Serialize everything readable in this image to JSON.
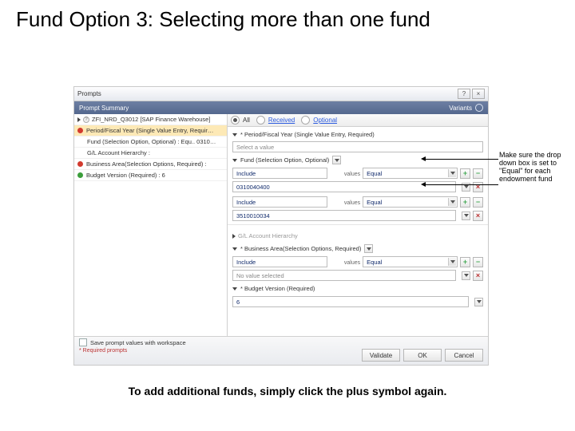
{
  "slide": {
    "title": "Fund Option 3: Selecting more than one fund",
    "caption": "To add additional funds, simply click the plus symbol again."
  },
  "annotation": "Make sure the drop down box is set to \"Equal\" for each endowment fund",
  "window": {
    "title": "Prompts",
    "summary": "Prompt Summary",
    "variants": "Variants"
  },
  "tabs": {
    "all": "All",
    "received": "Received",
    "optional": "Optional"
  },
  "left_items": [
    "ZFI_NRD_Q3012 [SAP Finance Warehouse]",
    "Period/Fiscal Year (Single Value Entry, Requir…",
    "Fund (Selection Option, Optional) : Equ.. 0310…",
    "G/L Account Hierarchy :",
    "Business Area(Selection Options, Required) :",
    "Budget Version (Required) : 6"
  ],
  "prompts": {
    "fiscal": {
      "label": "* Period/Fiscal Year (Single Value Entry, Required)",
      "placeholder": "Select a value"
    },
    "fund": {
      "label": "Fund (Selection Option, Optional)",
      "include": "Include",
      "valuesLabel": "values",
      "op": "Equal",
      "val0": "0310040400",
      "val1": "3510010034"
    },
    "gl": {
      "label": "G/L Account Hierarchy"
    },
    "ba": {
      "label": "* Business Area(Selection Options, Required)",
      "include": "Include",
      "op": "Equal",
      "noval": "No value selected"
    },
    "bv": {
      "label": "* Budget Version (Required)",
      "value": "6"
    }
  },
  "footer": {
    "savePrompt": "Save prompt values with workspace",
    "required": "* Required prompts",
    "validate": "Validate",
    "ok": "OK",
    "cancel": "Cancel"
  }
}
